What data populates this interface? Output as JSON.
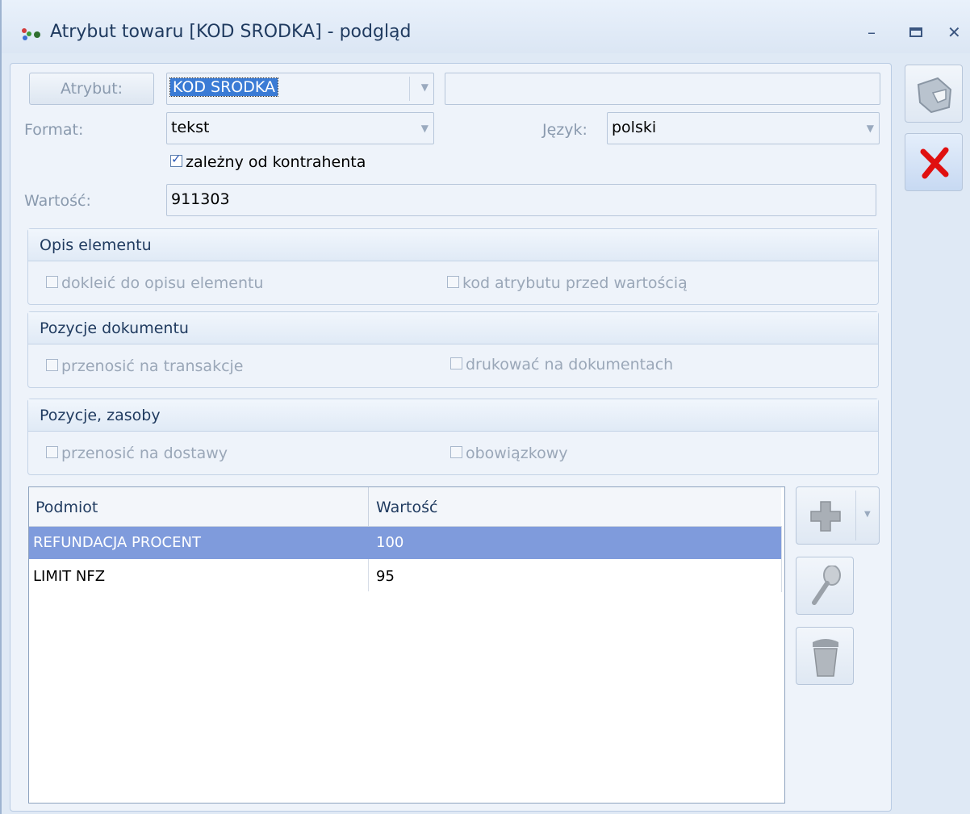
{
  "window": {
    "title": "Atrybut towaru [KOD SRODKA] - podgląd"
  },
  "form": {
    "attribute_button": "Atrybut:",
    "attribute_value": "KOD SRODKA",
    "attribute_extra": "",
    "format_label": "Format:",
    "format_value": "tekst",
    "language_label": "Język:",
    "language_value": "polski",
    "dependent_label": "zależny od kontrahenta",
    "dependent_checked": true,
    "value_label": "Wartość:",
    "value": "911303"
  },
  "groups": [
    {
      "title": "Opis elementu",
      "options": [
        {
          "label": "dokleić do opisu elementu",
          "checked": false
        },
        {
          "label": "kod atrybutu przed wartością",
          "checked": false
        }
      ]
    },
    {
      "title": "Pozycje dokumentu",
      "options": [
        {
          "label": "przenosić na transakcje",
          "checked": false
        },
        {
          "label": "drukować na dokumentach",
          "checked": false
        }
      ]
    },
    {
      "title": "Pozycje, zasoby",
      "options": [
        {
          "label": "przenosić na dostawy",
          "checked": false
        },
        {
          "label": "obowiązkowy",
          "checked": false
        }
      ]
    }
  ],
  "table": {
    "columns": [
      "Podmiot",
      "Wartość"
    ],
    "rows": [
      {
        "podmiot": "REFUNDACJA PROCENT",
        "wartosc": "100",
        "selected": true
      },
      {
        "podmiot": "LIMIT NFZ",
        "wartosc": "95",
        "selected": false
      }
    ]
  },
  "icons": [
    "app-icon",
    "minimize-icon",
    "maximize-icon",
    "close-icon",
    "save-icon",
    "cancel-icon",
    "add-icon",
    "dropdown-arrow-icon",
    "view-icon",
    "delete-icon"
  ],
  "colors": {
    "selection": "#7f9bdc",
    "cancel_red": "#e01010",
    "accent": "#3a7bd5"
  }
}
